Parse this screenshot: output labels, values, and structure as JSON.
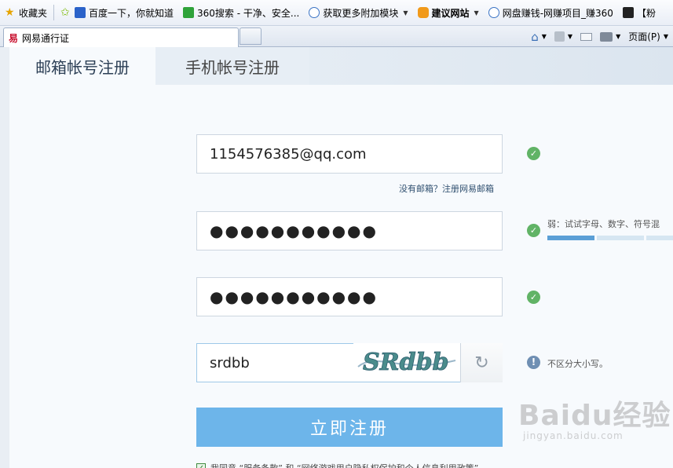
{
  "favorites_bar": {
    "items": [
      {
        "label": "收藏夹",
        "icon": "star-icon"
      },
      {
        "label": "百度一下，你就知道",
        "icon": "baidu-icon"
      },
      {
        "label": "360搜索 - 干净、安全...",
        "icon": "360-search-icon"
      },
      {
        "label": "获取更多附加模块",
        "icon": "ie-icon"
      },
      {
        "label": "建议网站",
        "icon": "suggested-sites-icon"
      },
      {
        "label": "网盘赚钱-网赚项目_赚360",
        "icon": "ie-icon"
      },
      {
        "label": "【粉",
        "icon": "page-icon"
      }
    ]
  },
  "browser_tab": {
    "title": "网易通行证",
    "icon": "netease-icon"
  },
  "toolbar": {
    "page_label": "页面(P)"
  },
  "page_tabs": {
    "email": "邮箱帐号注册",
    "phone": "手机帐号注册"
  },
  "form": {
    "email_value": "1154576385@qq.com",
    "no_email_link": "没有邮箱？注册网易邮箱",
    "password_value": "●●●●●●●●●●●",
    "confirm_value": "●●●●●●●●●●●",
    "strength_hint": "弱：试试字母、数字、符号混",
    "strength_level": 0.33,
    "captcha_value": "srdbb",
    "captcha_image_text": "SRdbb",
    "captcha_hint": "不区分大小写。",
    "submit_label": "立即注册",
    "agree_text": "我同意 “服务条款” 和 “网络游戏用户隐私权保护和个人信息利用政策”"
  },
  "watermark": {
    "big": "Baidu经验",
    "small": "jingyan.baidu.com"
  },
  "colors": {
    "accent": "#6db5ea",
    "success": "#61b366"
  }
}
